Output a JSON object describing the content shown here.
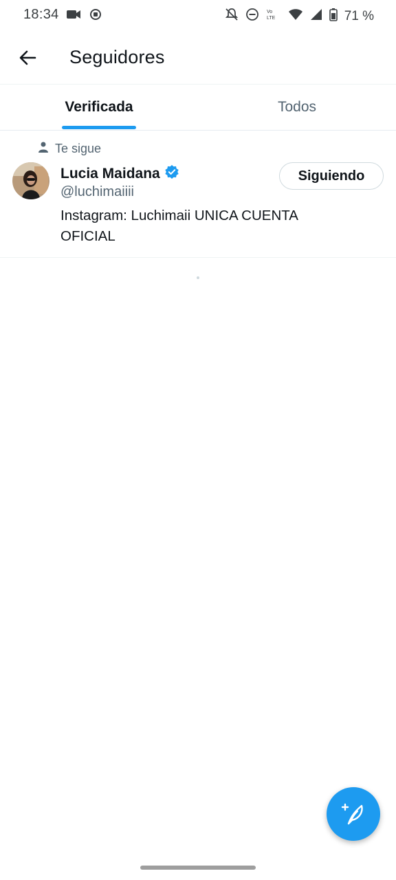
{
  "status_bar": {
    "time": "18:34",
    "battery_text": "71 %",
    "icons": [
      "video-icon",
      "record-icon",
      "mute-icon",
      "dnd-icon",
      "volte-icon",
      "wifi-icon",
      "signal-icon",
      "battery-icon"
    ]
  },
  "header": {
    "title": "Seguidores",
    "back_icon": "arrow-left-icon"
  },
  "tabs": [
    {
      "label": "Verificada",
      "active": true
    },
    {
      "label": "Todos",
      "active": false
    }
  ],
  "users": [
    {
      "context_label": "Te sigue",
      "name": "Lucia Maidana",
      "verified": true,
      "handle": "@luchimaiiii",
      "bio": "Instagram: Luchimaii  UNICA CUENTA OFICIAL",
      "follow_button_label": "Siguiendo"
    }
  ],
  "fab": {
    "icon": "compose-tweet-icon"
  },
  "colors": {
    "accent": "#1d9bf0",
    "text_primary": "#0f1419",
    "text_secondary": "#536471"
  }
}
